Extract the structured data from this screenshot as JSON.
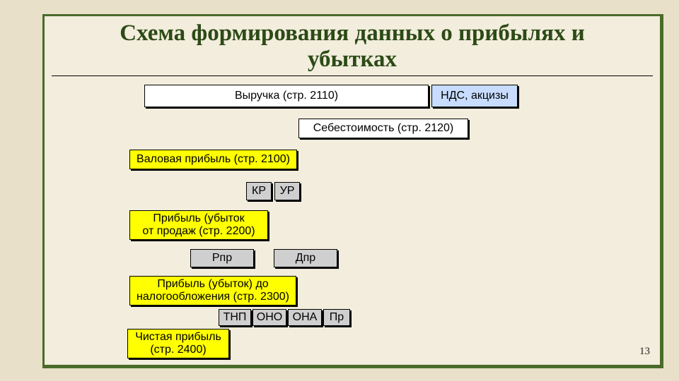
{
  "title": "Схема формирования данных о прибылях и убытках",
  "boxes": {
    "revenue": "Выручка (стр. 2110)",
    "vat": "НДС, акцизы",
    "cost": "Себестоимость (стр. 2120)",
    "gross": "Валовая прибыль (стр. 2100)",
    "kr": "КР",
    "ur": "УР",
    "sales_profit": "Прибыль (убыток\nот продаж (стр. 2200)",
    "rpr": "Рпр",
    "dpr": "Дпр",
    "pretax": "Прибыль (убыток) до\nналогообложения (стр. 2300)",
    "tnp": "ТНП",
    "ono": "ОНО",
    "ona": "ОНА",
    "pr": "Пр",
    "net": "Чистая прибыль\n(стр. 2400)"
  },
  "page_number": "13"
}
